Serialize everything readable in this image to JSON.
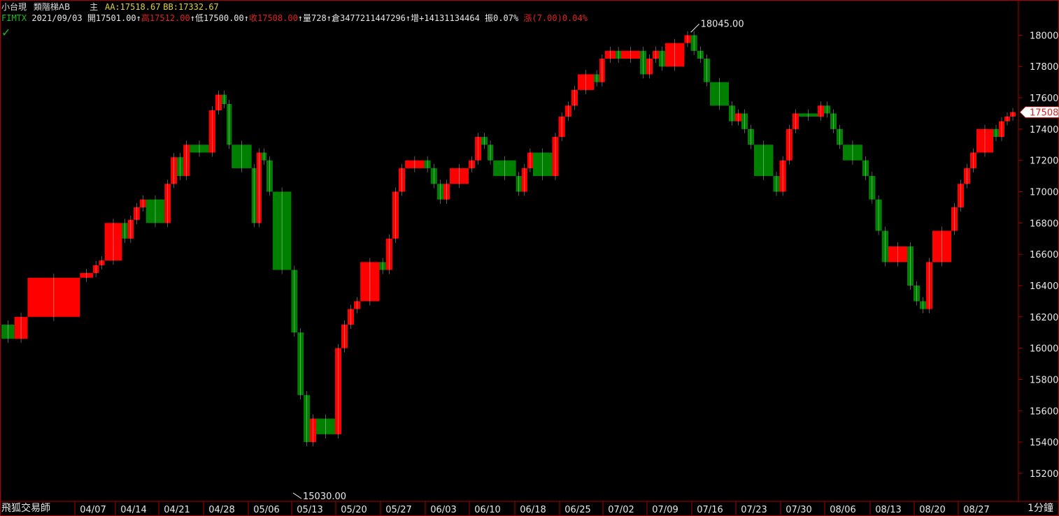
{
  "header": {
    "symbol": "小台現",
    "chart_style": "類階梯AB",
    "main_label": "主",
    "aa_label": "AA:",
    "aa_value": "17518.67",
    "bb_label": "BB:",
    "bb_value": "17332.67",
    "contract": "FIMTX",
    "date": "2021/09/03",
    "open_label": "開",
    "open_value": "17501.00",
    "high_label": "高",
    "high_value": "17512.00",
    "low_label": "低",
    "low_value": "17500.00",
    "close_label": "收",
    "close_value": "17508.00",
    "volume_label": "量",
    "volume_value": "728",
    "oi_label": "倉",
    "oi_value": "3477211447296",
    "oi_change_label": "增",
    "oi_change_value": "+14131134464",
    "amplitude_label": "振",
    "amplitude_value": "0.07%",
    "change_label": "漲",
    "change_value": "(7.00)0.04%",
    "arrow": "↑",
    "check_icon": "✓"
  },
  "footer": {
    "brand": "飛狐交易師",
    "interval": "1分鐘"
  },
  "colors": {
    "up": "#ff0000",
    "down": "#008000",
    "axis_frame": "#aa0000",
    "text": "#e8e8e8",
    "yellow_text": "#e0d040",
    "green_text": "#16c016",
    "red_text": "#e02020"
  },
  "chart_data": {
    "type": "line",
    "y_ticks": [
      15200,
      15400,
      15600,
      15800,
      16000,
      16200,
      16400,
      16600,
      16800,
      17000,
      17200,
      17400,
      17600,
      17800,
      18000
    ],
    "ylim": [
      15030,
      18100
    ],
    "x_ticks": [
      "04/07",
      "04/14",
      "04/21",
      "04/28",
      "05/06",
      "05/13",
      "05/20",
      "05/27",
      "06/03",
      "06/10",
      "06/18",
      "06/25",
      "07/02",
      "07/09",
      "07/16",
      "07/23",
      "07/30",
      "08/06",
      "08/13",
      "08/20",
      "08/27"
    ],
    "annotations": [
      {
        "text": "18045.00",
        "value": 18045,
        "date": "07/13"
      },
      {
        "text": "15030.00",
        "value": 15030,
        "date": "05/13"
      }
    ],
    "last_price": {
      "text": "17508",
      "value": 17508
    },
    "series": [
      {
        "points": [
          [
            "03/31",
            16150
          ],
          [
            "04/01",
            16060
          ],
          [
            "04/02",
            16200
          ],
          [
            "04/06",
            16450
          ],
          [
            "04/07",
            16480
          ],
          [
            "04/08",
            16530
          ],
          [
            "04/09",
            16560
          ],
          [
            "04/12",
            16800
          ],
          [
            "04/13",
            16700
          ],
          [
            "04/14",
            16820
          ],
          [
            "04/15",
            16900
          ],
          [
            "04/16",
            16950
          ],
          [
            "04/19",
            16800
          ],
          [
            "04/20",
            17050
          ],
          [
            "04/21",
            17220
          ],
          [
            "04/22",
            17100
          ],
          [
            "04/23",
            17300
          ],
          [
            "04/26",
            17250
          ],
          [
            "04/27",
            17520
          ],
          [
            "04/28",
            17620
          ],
          [
            "04/29",
            17560
          ],
          [
            "04/30",
            17300
          ],
          [
            "05/03",
            17150
          ],
          [
            "05/04",
            16800
          ],
          [
            "05/05",
            17250
          ],
          [
            "05/06",
            17200
          ],
          [
            "05/07",
            17000
          ],
          [
            "05/10",
            16500
          ],
          [
            "05/11",
            16100
          ],
          [
            "05/12",
            15700
          ],
          [
            "05/13",
            15400
          ],
          [
            "05/14",
            15550
          ],
          [
            "05/17",
            15450
          ],
          [
            "05/18",
            16000
          ],
          [
            "05/19",
            16150
          ],
          [
            "05/20",
            16250
          ],
          [
            "05/21",
            16300
          ],
          [
            "05/24",
            16550
          ],
          [
            "05/25",
            16500
          ],
          [
            "05/26",
            16700
          ],
          [
            "05/27",
            17000
          ],
          [
            "05/28",
            17150
          ],
          [
            "05/31",
            17200
          ],
          [
            "06/01",
            17150
          ],
          [
            "06/02",
            17050
          ],
          [
            "06/03",
            16950
          ],
          [
            "06/04",
            17050
          ],
          [
            "06/07",
            17150
          ],
          [
            "06/08",
            17200
          ],
          [
            "06/09",
            17350
          ],
          [
            "06/10",
            17300
          ],
          [
            "06/11",
            17200
          ],
          [
            "06/15",
            17100
          ],
          [
            "06/16",
            17000
          ],
          [
            "06/17",
            17150
          ],
          [
            "06/18",
            17250
          ],
          [
            "06/21",
            17100
          ],
          [
            "06/22",
            17350
          ],
          [
            "06/23",
            17480
          ],
          [
            "06/24",
            17550
          ],
          [
            "06/25",
            17650
          ],
          [
            "06/28",
            17750
          ],
          [
            "06/29",
            17700
          ],
          [
            "06/30",
            17850
          ],
          [
            "07/01",
            17900
          ],
          [
            "07/02",
            17850
          ],
          [
            "07/05",
            17900
          ],
          [
            "07/06",
            17750
          ],
          [
            "07/07",
            17850
          ],
          [
            "07/08",
            17900
          ],
          [
            "07/09",
            17800
          ],
          [
            "07/12",
            17950
          ],
          [
            "07/13",
            18000
          ],
          [
            "07/14",
            17900
          ],
          [
            "07/15",
            17850
          ],
          [
            "07/16",
            17700
          ],
          [
            "07/19",
            17550
          ],
          [
            "07/20",
            17450
          ],
          [
            "07/21",
            17500
          ],
          [
            "07/22",
            17400
          ],
          [
            "07/23",
            17300
          ],
          [
            "07/26",
            17100
          ],
          [
            "07/27",
            17000
          ],
          [
            "07/28",
            17200
          ],
          [
            "07/29",
            17400
          ],
          [
            "07/30",
            17500
          ],
          [
            "08/02",
            17480
          ],
          [
            "08/03",
            17550
          ],
          [
            "08/04",
            17500
          ],
          [
            "08/05",
            17400
          ],
          [
            "08/06",
            17300
          ],
          [
            "08/09",
            17200
          ],
          [
            "08/10",
            17100
          ],
          [
            "08/11",
            16950
          ],
          [
            "08/12",
            16750
          ],
          [
            "08/13",
            16550
          ],
          [
            "08/16",
            16650
          ],
          [
            "08/17",
            16400
          ],
          [
            "08/18",
            16300
          ],
          [
            "08/19",
            16250
          ],
          [
            "08/20",
            16550
          ],
          [
            "08/23",
            16750
          ],
          [
            "08/24",
            16900
          ],
          [
            "08/25",
            17050
          ],
          [
            "08/26",
            17150
          ],
          [
            "08/27",
            17250
          ],
          [
            "08/30",
            17400
          ],
          [
            "08/31",
            17350
          ],
          [
            "09/01",
            17450
          ],
          [
            "09/02",
            17480
          ],
          [
            "09/03",
            17508
          ]
        ]
      }
    ]
  }
}
